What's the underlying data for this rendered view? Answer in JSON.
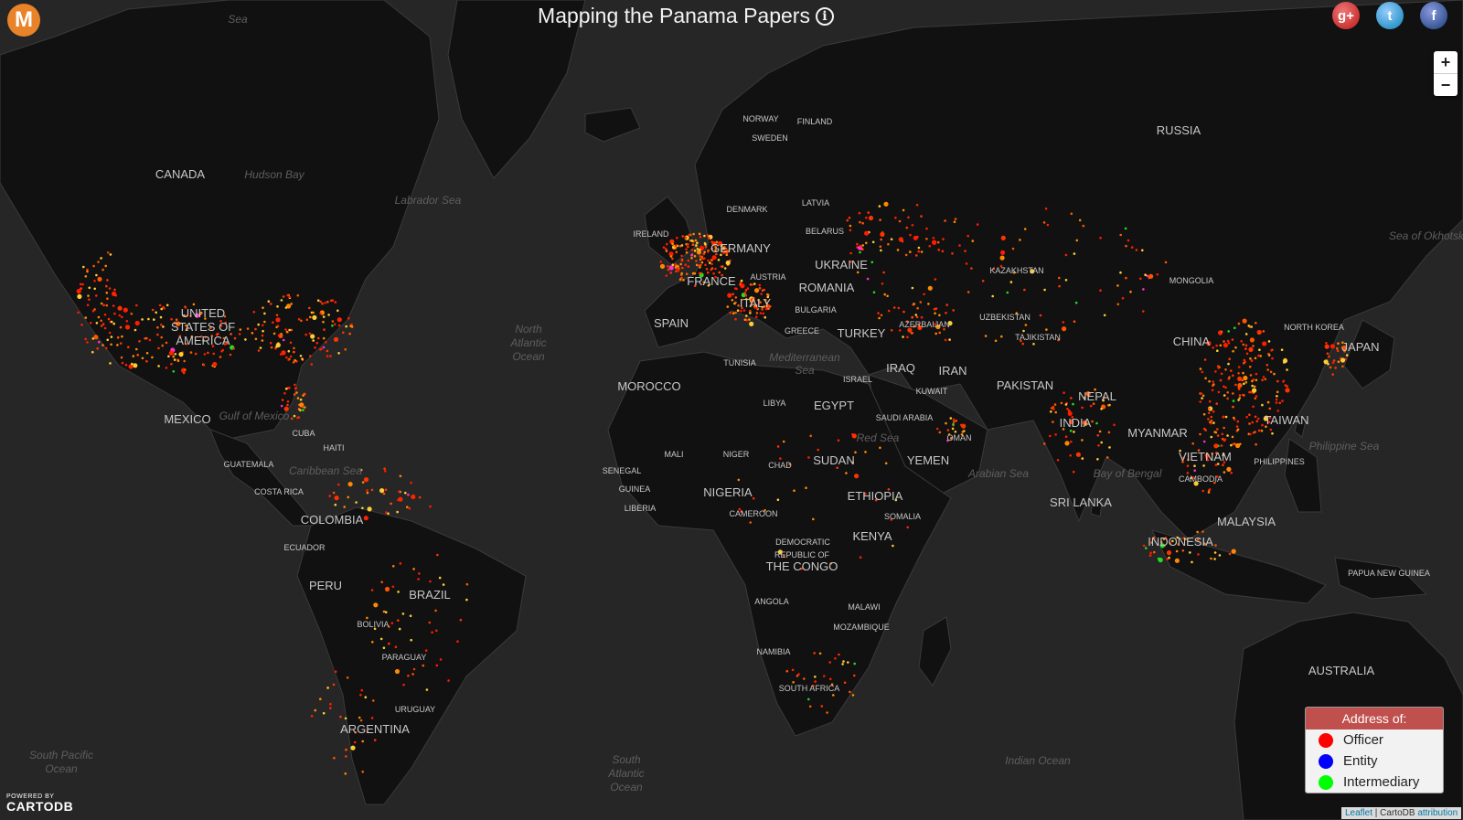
{
  "app": {
    "logo_letter": "M",
    "title": "Mapping the Panama Papers",
    "info_symbol": "i"
  },
  "social": [
    {
      "name": "google-plus",
      "glyph": "g+"
    },
    {
      "name": "twitter",
      "glyph": "t"
    },
    {
      "name": "facebook",
      "glyph": "f"
    }
  ],
  "zoom": {
    "in": "+",
    "out": "−"
  },
  "legend": {
    "title": "Address of:",
    "items": [
      {
        "label": "Officer",
        "color": "#ff0000"
      },
      {
        "label": "Entity",
        "color": "#0000ff"
      },
      {
        "label": "Intermediary",
        "color": "#00ff00"
      }
    ]
  },
  "branding": {
    "powered_by": "POWERED BY",
    "provider": "CARTODB"
  },
  "attribution": {
    "leaflet": "Leaflet",
    "sep": " | CartoDB ",
    "link": "attribution"
  },
  "map": {
    "colors": {
      "land": "#111111",
      "water": "#262626",
      "border": "#3a3a3a"
    },
    "country_labels": [
      "CANADA",
      "UNITED",
      "STATES OF",
      "AMERICA",
      "MEXICO",
      "CUBA",
      "HAITI",
      "GUATEMALA",
      "COSTA RICA",
      "COLOMBIA",
      "ECUADOR",
      "PERU",
      "BRAZIL",
      "BOLIVIA",
      "PARAGUAY",
      "URUGUAY",
      "ARGENTINA",
      "IRELAND",
      "NORWAY",
      "FINLAND",
      "SWEDEN",
      "DENMARK",
      "LATVIA",
      "BELARUS",
      "GERMANY",
      "UKRAINE",
      "FRANCE",
      "AUSTRIA",
      "ROMANIA",
      "SPAIN",
      "ITALY",
      "BULGARIA",
      "GREECE",
      "TURKEY",
      "MOROCCO",
      "TUNISIA",
      "LIBYA",
      "EGYPT",
      "ISRAEL",
      "IRAQ",
      "IRAN",
      "KUWAIT",
      "SAUDI ARABIA",
      "OMAN",
      "YEMEN",
      "SUDAN",
      "CHAD",
      "NIGER",
      "MALI",
      "SENEGAL",
      "GUINEA",
      "LIBERIA",
      "NIGERIA",
      "CAMEROON",
      "ETHIOPIA",
      "SOMALIA",
      "KENYA",
      "DEMOCRATIC",
      "REPUBLIC OF",
      "THE CONGO",
      "ANGOLA",
      "MALAWI",
      "MOZAMBIQUE",
      "NAMIBIA",
      "SOUTH AFRICA",
      "RUSSIA",
      "KAZAKHSTAN",
      "UZBEKISTAN",
      "TAJIKISTAN",
      "AZERBAIJAN",
      "PAKISTAN",
      "MONGOLIA",
      "CHINA",
      "NORTH KOREA",
      "JAPAN",
      "NEPAL",
      "INDIA",
      "SRI LANKA",
      "MYANMAR",
      "VIETNAM",
      "CAMBODIA",
      "TAIWAN",
      "PHILIPPINES",
      "MALAYSIA",
      "INDONESIA",
      "PAPUA NEW GUINEA",
      "AUSTRALIA"
    ],
    "water_labels": [
      "Hudson Bay",
      "Labrador Sea",
      "North",
      "Atlantic",
      "Ocean",
      "Gulf of Mexico",
      "Caribbean Sea",
      "Mediterranean",
      "Sea",
      "Red Sea",
      "Arabian Sea",
      "Bay of Bengal",
      "Philippine Sea",
      "Sea of Okhotsk",
      "South Pacific",
      "Ocean",
      "South",
      "Atlantic",
      "Ocean",
      "Indian Ocean",
      "Sea"
    ]
  }
}
